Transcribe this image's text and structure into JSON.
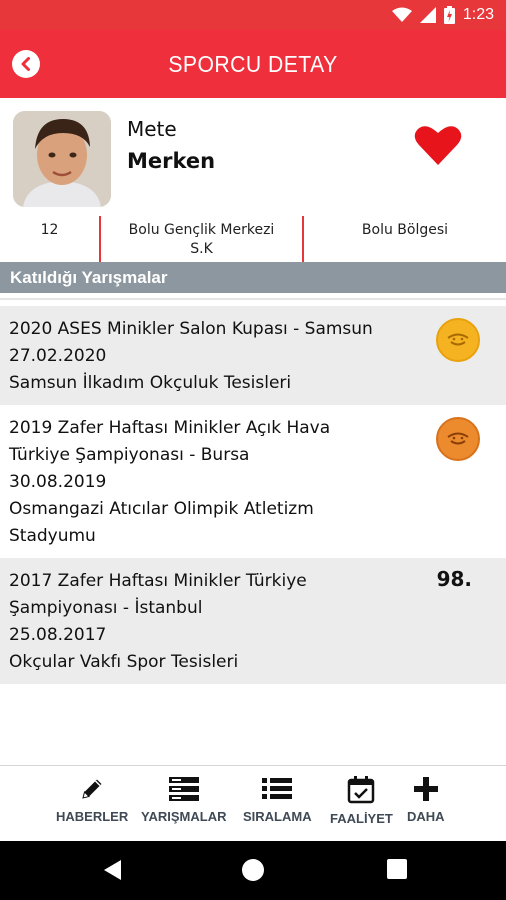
{
  "status_bar": {
    "time": "1:23"
  },
  "app_bar": {
    "title": "SPORCU DETAY"
  },
  "profile": {
    "first_name": "Mete",
    "last_name": "Merken"
  },
  "info": {
    "age": "12",
    "club_line1": "Bolu Gençlik Merkezi",
    "club_line2": "S.K",
    "region": "Bolu Bölgesi"
  },
  "section": {
    "title": "Katıldığı Yarışmalar"
  },
  "competitions": [
    {
      "lines": [
        "2020 ASES Minikler Salon Kupası - Samsun",
        "27.02.2020",
        "Samsun İlkadım Okçuluk Tesisleri"
      ],
      "result_type": "medal",
      "medal": "gold"
    },
    {
      "lines": [
        "2019 Zafer Haftası Minikler Açık Hava",
        "Türkiye Şampiyonası - Bursa",
        "30.08.2019",
        "Osmangazi Atıcılar Olimpik Atletizm",
        "Stadyumu"
      ],
      "result_type": "medal",
      "medal": "bronze"
    },
    {
      "lines": [
        "2017 Zafer Haftası Minikler Türkiye",
        "Şampiyonası - İstanbul",
        "25.08.2017",
        "Okçular Vakfı Spor Tesisleri"
      ],
      "result_type": "rank",
      "rank": "98."
    }
  ],
  "bottom_nav": [
    {
      "label": "HABERLER",
      "icon": "pencil-icon"
    },
    {
      "label": "YARIŞMALAR",
      "icon": "list-bars-icon"
    },
    {
      "label": "SIRALAMA",
      "icon": "bulleted-list-icon"
    },
    {
      "label": "FAALİYET",
      "icon": "calendar-check-icon"
    },
    {
      "label": "DAHA",
      "icon": "plus-icon"
    }
  ],
  "colors": {
    "brand_red": "#ef2f3b",
    "section_gray": "#8c979f",
    "gold": "#f5b322",
    "bronze": "#ec8a2e"
  }
}
